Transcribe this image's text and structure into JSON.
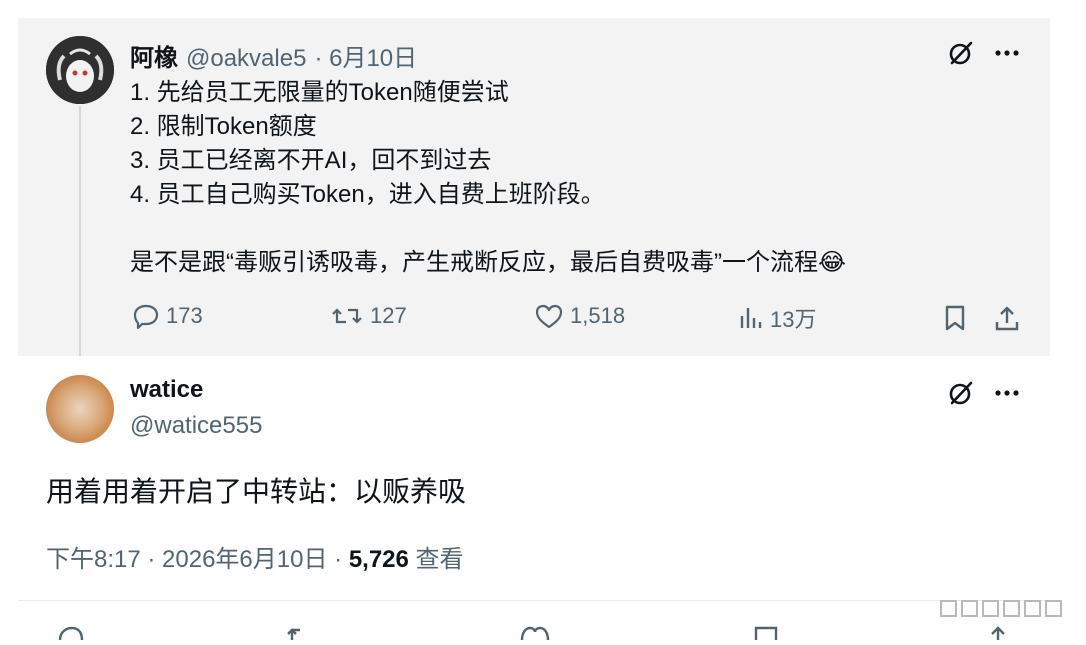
{
  "original_post": {
    "display_name": "阿橡",
    "handle": "@oakvale5",
    "date": "· 6月10日",
    "lines": [
      "1. 先给员工无限量的Token随便尝试",
      "2. 限制Token额度",
      "3. 员工已经离不开AI，回不到过去",
      "4. 员工自己购买Token，进入自费上班阶段。",
      "",
      "是不是跟“毒贩引诱吸毒，产生戒断反应，最后自费吸毒”一个流程😂"
    ],
    "stats": {
      "replies": "173",
      "reposts": "127",
      "likes": "1,518",
      "views": "13万"
    }
  },
  "reply_post": {
    "display_name": "watice",
    "handle": "@watice555",
    "text": "用着用着开启了中转站：以贩养吸",
    "time": "下午8:17 · 2026年6月10日 · ",
    "views_count": "5,726",
    "views_label": " 查看"
  },
  "icons": {
    "grok": "grok-icon",
    "more": "more-icon",
    "reply": "reply-icon",
    "repost": "repost-icon",
    "like": "like-icon",
    "views": "views-icon",
    "bookmark": "bookmark-icon",
    "share": "share-icon"
  },
  "colors": {
    "original_bg": "#f3f3f3",
    "secondary_text": "#536471",
    "primary_text": "#0f1419"
  }
}
